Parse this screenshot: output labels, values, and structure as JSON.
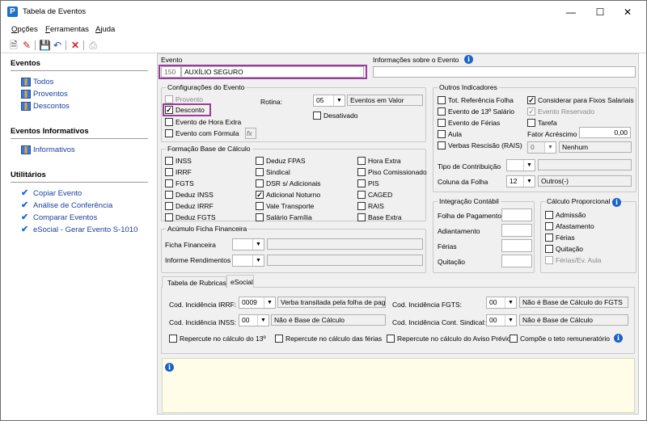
{
  "window": {
    "title": "Tabela de Eventos"
  },
  "menu": [
    {
      "label": "Opções",
      "u": "O"
    },
    {
      "label": "Ferramentas",
      "u": "F"
    },
    {
      "label": "Ajuda",
      "u": "A"
    }
  ],
  "toolbar": {
    "icons": [
      "new-icon",
      "edit-icon",
      "save-icon",
      "undo-icon",
      "delete-icon",
      "print-icon"
    ]
  },
  "sidebar": {
    "eventos": {
      "title": "Eventos",
      "items": [
        "Todos",
        "Proventos",
        "Descontos"
      ]
    },
    "informativos": {
      "title": "Eventos Informativos",
      "items": [
        "Informativos"
      ]
    },
    "utilitarios": {
      "title": "Utilitários",
      "items": [
        "Copiar Evento",
        "Análise de Conferência",
        "Comparar Eventos",
        "eSocial - Gerar Evento S-1010"
      ]
    }
  },
  "evento": {
    "label": "Evento",
    "code": "150",
    "name": "AUXÍLIO SEGURO",
    "info_label": "Informações sobre o Evento",
    "info_value": ""
  },
  "config": {
    "title": "Configurações do Evento",
    "provento": "Provento",
    "desconto": "Desconto",
    "hora_extra": "Evento de Hora Extra",
    "formula": "Evento com Fórmula",
    "rotina_label": "Rotina:",
    "rotina_value": "05",
    "rotina_desc": "Eventos em Valor",
    "desativado": "Desativado",
    "fx": "fx"
  },
  "outros": {
    "title": "Outros Indicadores",
    "items": [
      "Tot. Referência Folha",
      "Evento de 13º Salário",
      "Evento de Férias",
      "Aula",
      "Verbas Rescisão (RAIS)"
    ],
    "right": [
      "Considerar para Fixos Salariais",
      "Evento Reservado",
      "Tarefa"
    ],
    "fator_label": "Fator Acréscimo",
    "fator_value": "0,00",
    "num_value": "0",
    "num_desc": "Nenhum",
    "tipo_contrib_label": "Tipo de Contribuição",
    "tipo_contrib_value": "",
    "coluna_label": "Coluna da Folha",
    "coluna_value": "12",
    "coluna_desc": "Outros(-)"
  },
  "formacao": {
    "title": "Formação Base de Cálculo",
    "col1": [
      "INSS",
      "IRRF",
      "FGTS",
      "Deduz INSS",
      "Deduz IRRF",
      "Deduz FGTS"
    ],
    "col2": [
      "Deduz FPAS",
      "Sindical",
      "DSR s/ Adicionais",
      "Adicional Noturno",
      "Vale Transporte",
      "Salário Família"
    ],
    "col3": [
      "Hora Extra",
      "Piso Comissionado",
      "PIS",
      "CAGED",
      "RAIS",
      "Base Extra"
    ],
    "checked": [
      "Adicional Noturno"
    ]
  },
  "acumulo": {
    "title": "Acúmulo Ficha Financeira",
    "ficha_label": "Ficha Financeira",
    "informe_label": "Informe Rendimentos"
  },
  "integracao": {
    "title": "Integração Contábil",
    "items": [
      "Folha de Pagamento",
      "Adiantamento",
      "Férias",
      "Quitação"
    ]
  },
  "proporcional": {
    "title": "Cálculo Proporcional",
    "items": [
      "Admissão",
      "Afastamento",
      "Férias",
      "Quitação",
      "Férias/Ev. Aula"
    ]
  },
  "tabs": [
    "Tabela de Rubricas",
    "eSocial"
  ],
  "esocial": {
    "irrf_label": "Cod. Incidência IRRF:",
    "irrf_value": "0009",
    "irrf_desc": "Verba transitada pela folha de paga",
    "inss_label": "Cod. Incidência INSS:",
    "inss_value": "00",
    "inss_desc": "Não é Base de Cálculo",
    "fgts_label": "Cod. Incidência FGTS:",
    "fgts_value": "00",
    "fgts_desc": "Não é Base de Cálculo do FGTS",
    "sind_label": "Cod. Incidência Cont. Sindical:",
    "sind_value": "00",
    "sind_desc": "Não é Base de Cálculo",
    "checks": [
      "Repercute no cálculo do 13º",
      "Repercute no cálculo das férias",
      "Repercute no cálculo do Aviso Prévio",
      "Compõe o teto remuneratório"
    ]
  },
  "colors": {
    "highlight": "#9b3b9b",
    "link": "#1a3f9e",
    "note_bg": "#fffde8"
  }
}
